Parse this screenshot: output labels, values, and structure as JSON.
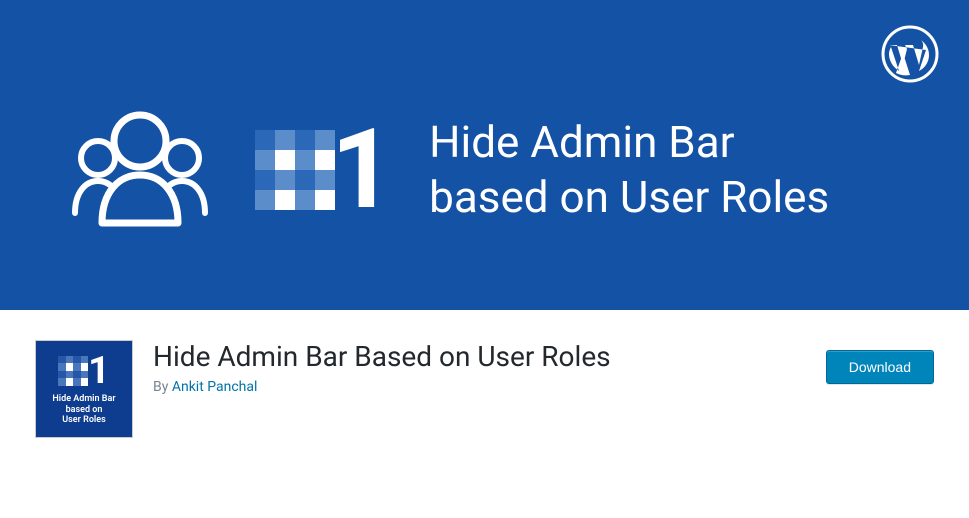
{
  "banner": {
    "hash_number": "1",
    "title_line1": "Hide Admin Bar",
    "title_line2": "based on User Roles"
  },
  "plugin": {
    "icon_hash_number": "1",
    "icon_text_line1": "Hide Admin Bar",
    "icon_text_line2": "based on",
    "icon_text_line3": "User Roles",
    "title": "Hide Admin Bar Based on User Roles",
    "by_prefix": "By ",
    "author": "Ankit Panchal"
  },
  "actions": {
    "download_label": "Download"
  }
}
